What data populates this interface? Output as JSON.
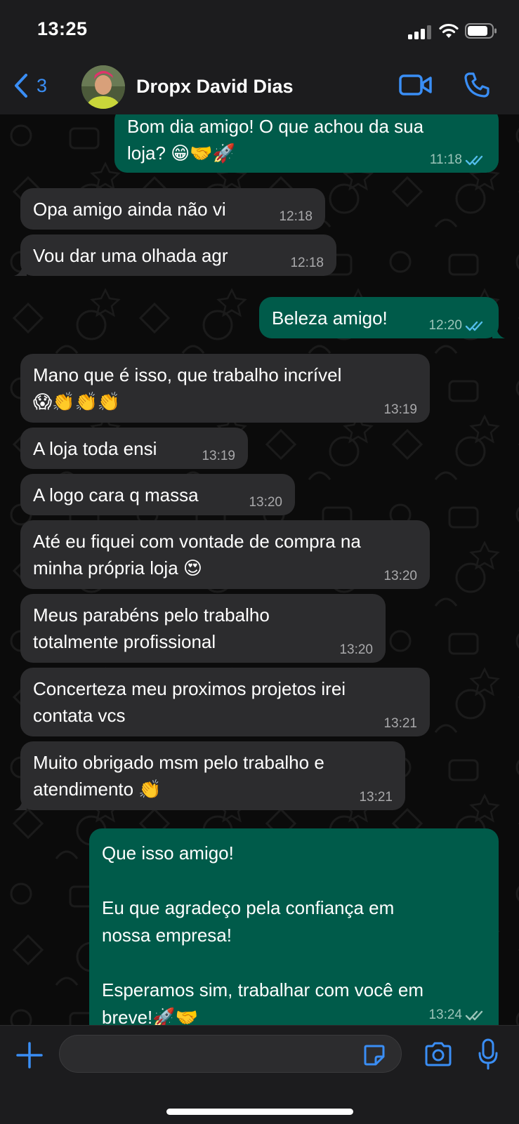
{
  "status_bar": {
    "time": "13:25"
  },
  "header": {
    "back_count": "3",
    "contact_name": "Dropx David Dias"
  },
  "messages": [
    {
      "dir": "out",
      "text": "Bom dia amigo! O que achou da sua\nloja? 😁🤝🚀",
      "time": "11:18",
      "read": true
    },
    {
      "dir": "in",
      "text": "Opa amigo ainda não vi",
      "time": "12:18"
    },
    {
      "dir": "in",
      "text": "Vou dar uma olhada agr",
      "time": "12:18"
    },
    {
      "dir": "out",
      "text": "Beleza amigo!",
      "time": "12:20",
      "read": true
    },
    {
      "dir": "in",
      "text": "Mano que é isso, que trabalho incrível\n😱👏👏👏",
      "time": "13:19"
    },
    {
      "dir": "in",
      "text": "A loja toda ensi",
      "time": "13:19"
    },
    {
      "dir": "in",
      "text": "A logo cara q massa",
      "time": "13:20"
    },
    {
      "dir": "in",
      "text": "Até eu fiquei com vontade de compra na\nminha própria loja 😍",
      "time": "13:20"
    },
    {
      "dir": "in",
      "text": "Meus parabéns pelo trabalho\ntotalmente profissional",
      "time": "13:20"
    },
    {
      "dir": "in",
      "text": "Concerteza meu proximos projetos irei\ncontata vcs",
      "time": "13:21"
    },
    {
      "dir": "in",
      "text": "Muito obrigado msm pelo trabalho e\natendimento 👏",
      "time": "13:21"
    },
    {
      "dir": "out",
      "text": "Que isso amigo!\n\nEu que agradeço pela confiança em\nnossa empresa!\n\nEsperamos sim, trabalhar com você em\nbreve!🚀🤝",
      "time": "13:24",
      "read": false
    }
  ],
  "colors": {
    "accent": "#3a8ef5",
    "outgoing_bubble": "#005b4a",
    "incoming_bubble": "#2c2c2e",
    "read_tick": "#53bdeb"
  }
}
